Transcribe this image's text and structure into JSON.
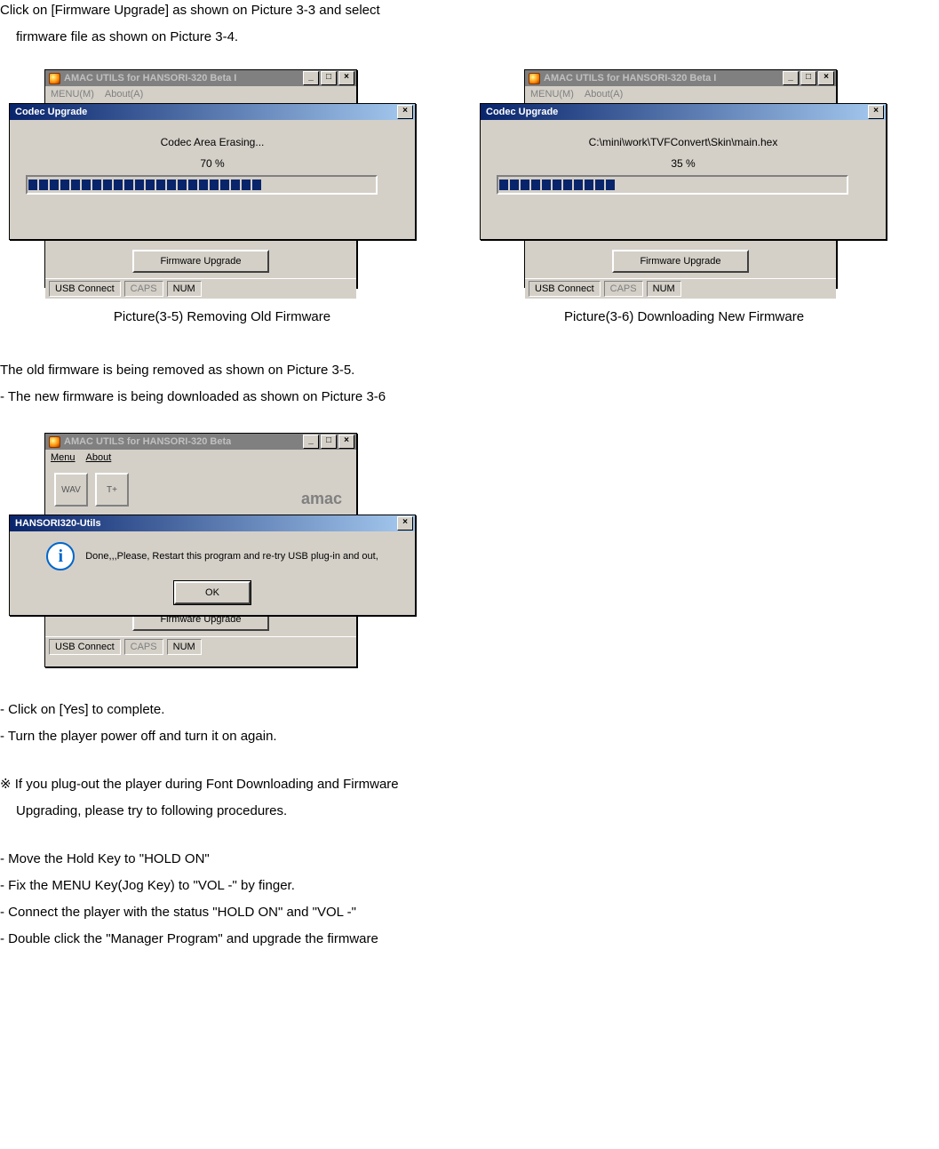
{
  "text": {
    "p1": "Click on [Firmware Upgrade] as shown on Picture 3-3 and select",
    "p1b": "firmware file as shown on Picture 3-4.",
    "cap35": "Picture(3-5) Removing Old Firmware",
    "cap36": "Picture(3-6) Downloading New Firmware",
    "p2": "The old firmware is being removed as shown on Picture 3-5.",
    "p3": "- The new firmware is being downloaded as shown on Picture 3-6",
    "p4": "- Click on [Yes] to complete.",
    "p5": "- Turn the player power off and turn it on again.",
    "p6": "※ If you plug-out the player during Font Downloading and Firmware",
    "p6b": "Upgrading, please try to following procedures.",
    "p7": "- Move the Hold Key to \"HOLD ON\"",
    "p8": "- Fix the MENU Key(Jog Key) to \"VOL -\" by finger.",
    "p9": "- Connect the player with the status \"HOLD ON\" and \"VOL -\"",
    "p10": "- Double click the \"Manager Program\" and upgrade the firmware"
  },
  "win35": {
    "title": "AMAC UTILS for HANSORI-320 Beta I",
    "menu_m": "MENU(M)",
    "menu_a": "About(A)",
    "dlg_title": "Codec Upgrade",
    "dlg_msg": "Codec Area Erasing...",
    "dlg_pct": "70 %",
    "dlg_percent": 70,
    "btn_upgrade": "Firmware Upgrade",
    "status_usb": "USB Connect",
    "status_caps": "CAPS",
    "status_num": "NUM"
  },
  "win36": {
    "title": "AMAC UTILS for HANSORI-320 Beta I",
    "menu_m": "MENU(M)",
    "menu_a": "About(A)",
    "dlg_title": "Codec Upgrade",
    "dlg_msg": "C:\\mini\\work\\TVFConvert\\Skin\\main.hex",
    "dlg_pct": "35 %",
    "dlg_percent": 35,
    "btn_upgrade": "Firmware Upgrade",
    "status_usb": "USB Connect",
    "status_caps": "CAPS",
    "status_num": "NUM"
  },
  "win37": {
    "title": "AMAC UTILS for HANSORI-320 Beta",
    "menu_m": "Menu",
    "menu_a": "About",
    "brand": "amac",
    "msg_title": "HANSORI320-Utils",
    "msg_text": "Done,,,Please, Restart this program and re-try USB plug-in and out,",
    "msg_ok": "OK",
    "btn_upgrade": "Firmware Upgrade",
    "status_usb": "USB Connect",
    "status_caps": "CAPS",
    "status_num": "NUM",
    "ico_wav": "WAV",
    "ico_t": "T+"
  },
  "glyph": {
    "min": "_",
    "max": "□",
    "close": "×",
    "info": "i"
  }
}
